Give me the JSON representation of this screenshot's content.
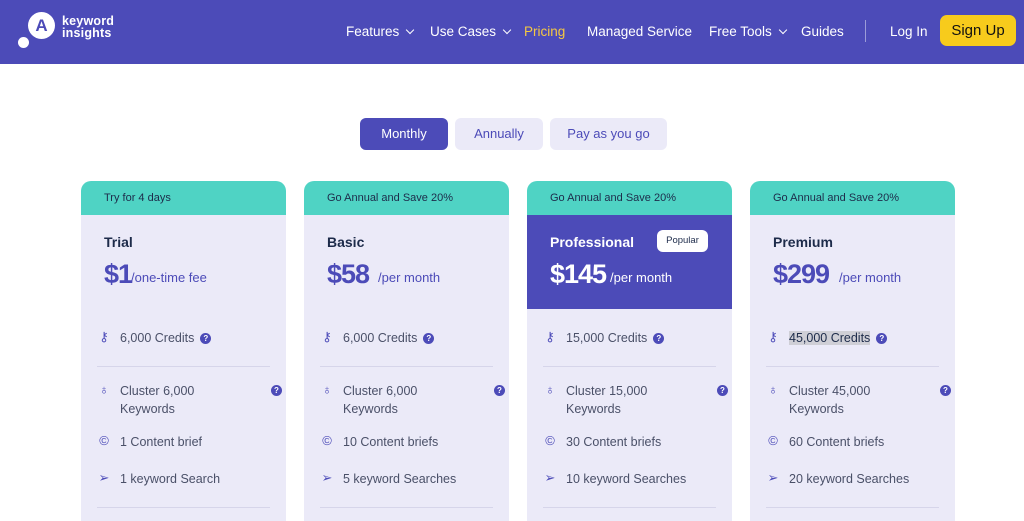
{
  "brand": {
    "line1": "keyword",
    "line2": "insights",
    "mark": "A"
  },
  "nav": {
    "items": [
      {
        "label": "Features",
        "dropdown": true
      },
      {
        "label": "Use Cases",
        "dropdown": true
      },
      {
        "label": "Pricing",
        "active": true
      },
      {
        "label": "Managed Service"
      },
      {
        "label": "Free Tools",
        "dropdown": true
      },
      {
        "label": "Guides"
      }
    ],
    "login": "Log In",
    "signup": "Sign Up"
  },
  "billing_tabs": [
    {
      "label": "Monthly",
      "selected": true
    },
    {
      "label": "Annually",
      "selected": false
    },
    {
      "label": "Pay as you go",
      "selected": false
    }
  ],
  "plans": [
    {
      "banner": "Try for 4 days",
      "name": "Trial",
      "price": "$1",
      "period": "/one-time fee",
      "features": [
        "6,000 Credits",
        "Cluster 6,000",
        "Keywords",
        "1 Content brief",
        "1 keyword Search"
      ]
    },
    {
      "banner": "Go Annual and Save 20%",
      "name": "Basic",
      "price": "$58",
      "period": "/per month",
      "features": [
        "6,000 Credits",
        "Cluster 6,000",
        "Keywords",
        "10 Content briefs",
        "5 keyword Searches"
      ]
    },
    {
      "banner": "Go Annual and Save 20%",
      "name": "Professional",
      "price": "$145",
      "period": "/per month",
      "badge": "Popular",
      "features": [
        "15,000 Credits",
        "Cluster 15,000",
        "Keywords",
        "30 Content briefs",
        "10 keyword Searches"
      ]
    },
    {
      "banner": "Go Annual and Save 20%",
      "name": "Premium",
      "price": "$299",
      "period": "/per month",
      "features": [
        "45,000 Credits",
        "Cluster 45,000",
        "Keywords",
        "60 Content briefs",
        "20 keyword Searches"
      ]
    }
  ],
  "help_glyph": "?",
  "icons": {
    "credits": "key-icon",
    "cluster": "lightbulb-icon",
    "brief": "content-brief-icon",
    "search": "send-icon",
    "help": "help-icon",
    "dropdown": "chevron-down-icon"
  },
  "colors": {
    "brand": "#4c4bb8",
    "teal": "#4fd3c4",
    "yellow": "#f7cb1c",
    "tint": "#ebeaf8"
  }
}
